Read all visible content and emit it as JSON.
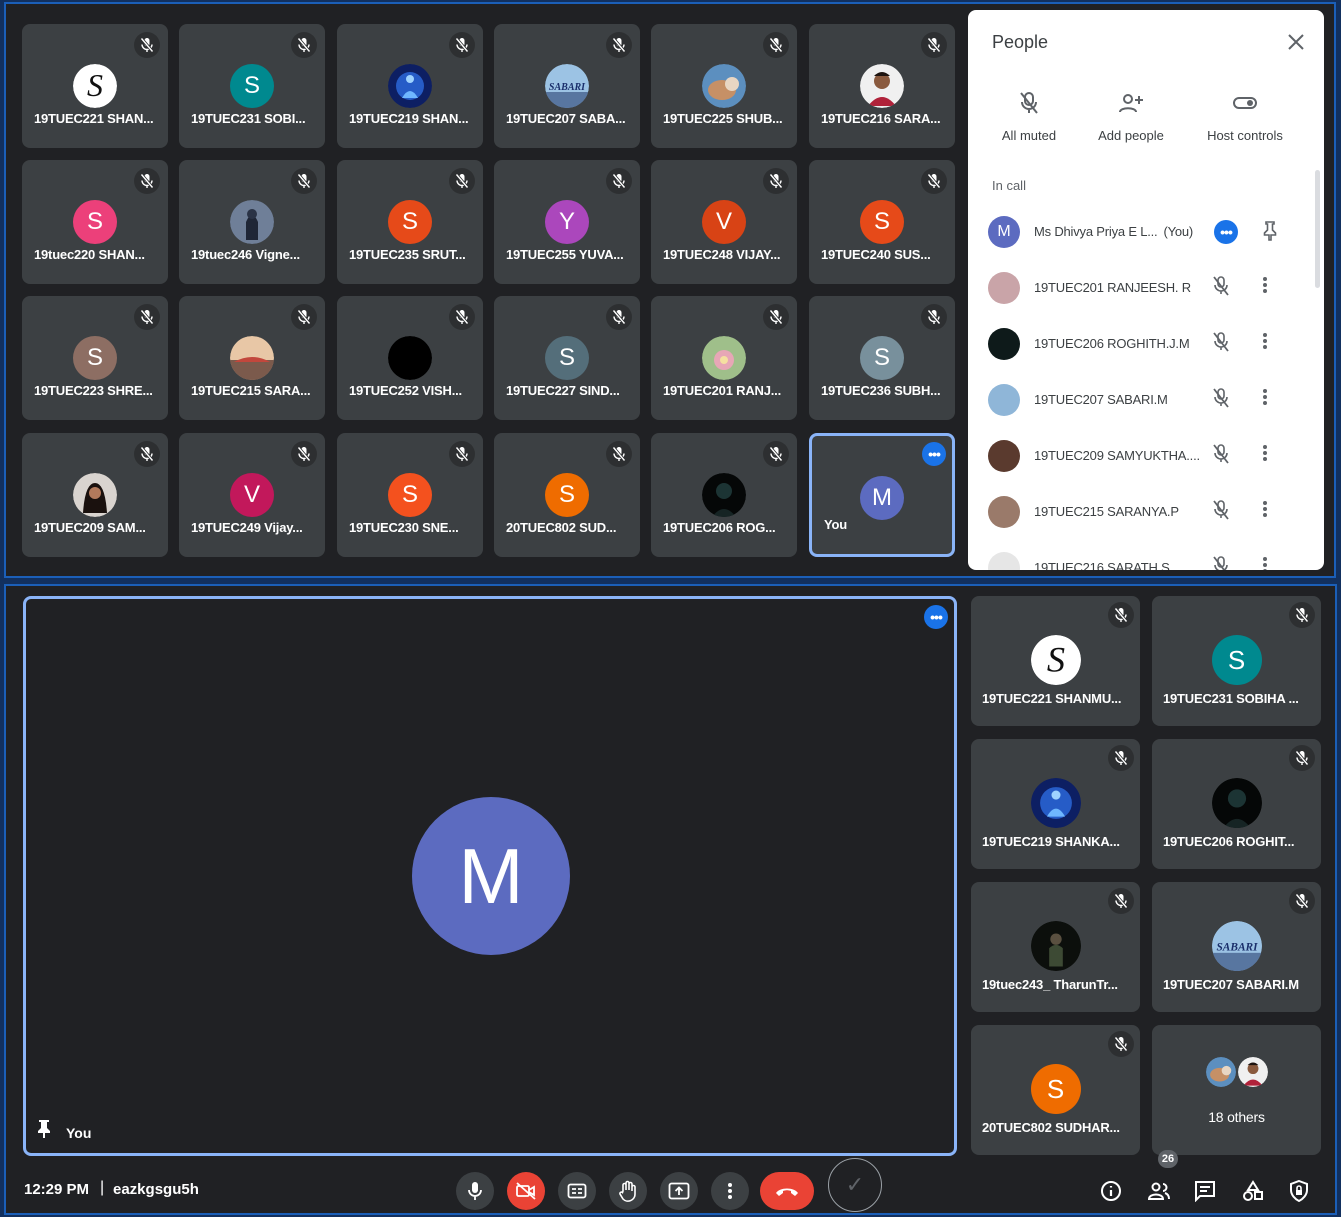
{
  "top_grid": {
    "tiles": [
      {
        "name": "19TUEC221 SHAN...",
        "initial": "",
        "avatar_color": "#ffffff",
        "avatar_type": "logo-s"
      },
      {
        "name": "19TUEC231 SOBI...",
        "initial": "S",
        "avatar_color": "#00898f",
        "avatar_type": "letter"
      },
      {
        "name": "19TUEC219 SHAN...",
        "initial": "",
        "avatar_color": "#1b3f9a",
        "avatar_type": "photo-blue"
      },
      {
        "name": "19TUEC207 SABA...",
        "initial": "",
        "avatar_color": "#8fb6d8",
        "avatar_type": "photo-sabari"
      },
      {
        "name": "19TUEC225 SHUB...",
        "initial": "",
        "avatar_color": "#b47c55",
        "avatar_type": "photo-cat"
      },
      {
        "name": "19TUEC216 SARA...",
        "initial": "",
        "avatar_color": "#e6e6e6",
        "avatar_type": "photo-man"
      },
      {
        "name": "19tuec220 SHAN...",
        "initial": "S",
        "avatar_color": "#ec407a",
        "avatar_type": "letter"
      },
      {
        "name": "19tuec246 Vigne...",
        "initial": "",
        "avatar_color": "#4a5a78",
        "avatar_type": "photo-statue"
      },
      {
        "name": "19TUEC235 SRUT...",
        "initial": "S",
        "avatar_color": "#e64a19",
        "avatar_type": "letter"
      },
      {
        "name": "19TUEC255 YUVA...",
        "initial": "Y",
        "avatar_color": "#ab47bc",
        "avatar_type": "letter"
      },
      {
        "name": "19TUEC248 VIJAY...",
        "initial": "V",
        "avatar_color": "#d84315",
        "avatar_type": "letter"
      },
      {
        "name": "19TUEC240 SUS...",
        "initial": "S",
        "avatar_color": "#e64a19",
        "avatar_type": "letter"
      },
      {
        "name": "19TUEC223 SHRE...",
        "initial": "S",
        "avatar_color": "#8d6e63",
        "avatar_type": "letter"
      },
      {
        "name": "19TUEC215 SARA...",
        "initial": "",
        "avatar_color": "#9a7a6a",
        "avatar_type": "photo-sunset"
      },
      {
        "name": "19TUEC252 VISH...",
        "initial": "",
        "avatar_color": "#000000",
        "avatar_type": "photo-black"
      },
      {
        "name": "19TUEC227 SIND...",
        "initial": "S",
        "avatar_color": "#546e7a",
        "avatar_type": "letter"
      },
      {
        "name": "19TUEC201 RANJ...",
        "initial": "",
        "avatar_color": "#c9a4a8",
        "avatar_type": "photo-flower"
      },
      {
        "name": "19TUEC236 SUBH...",
        "initial": "S",
        "avatar_color": "#78909c",
        "avatar_type": "letter"
      },
      {
        "name": "19TUEC209 SAM...",
        "initial": "",
        "avatar_color": "#5a3a2e",
        "avatar_type": "photo-girl"
      },
      {
        "name": "19TUEC249 Vijay...",
        "initial": "V",
        "avatar_color": "#c2185b",
        "avatar_type": "letter"
      },
      {
        "name": "19TUEC230 SNE...",
        "initial": "S",
        "avatar_color": "#f4511e",
        "avatar_type": "letter"
      },
      {
        "name": "20TUEC802 SUD...",
        "initial": "S",
        "avatar_color": "#ef6c00",
        "avatar_type": "letter"
      },
      {
        "name": "19TUEC206 ROG...",
        "initial": "",
        "avatar_color": "#0e1a1a",
        "avatar_type": "photo-dark"
      },
      {
        "name": "You",
        "initial": "M",
        "avatar_color": "#5c6bc0",
        "avatar_type": "letter",
        "is_self": true
      }
    ]
  },
  "people_panel": {
    "title": "People",
    "actions": [
      {
        "label": "All muted",
        "icon": "mic-off-icon"
      },
      {
        "label": "Add people",
        "icon": "add-person-icon"
      },
      {
        "label": "Host controls",
        "icon": "toggle-icon"
      }
    ],
    "section_label": "In call",
    "participants": [
      {
        "name": "Ms Dhivya Priya E L...",
        "suffix": "(You)",
        "initial": "M",
        "avatar_color": "#5c6bc0",
        "is_self": true
      },
      {
        "name": "19TUEC201 RANJEESH. R",
        "initial": "",
        "avatar_color": "#c9a4a8"
      },
      {
        "name": "19TUEC206 ROGHITH.J.M",
        "initial": "",
        "avatar_color": "#0e1a1a"
      },
      {
        "name": "19TUEC207 SABARI.M",
        "initial": "",
        "avatar_color": "#8fb6d8"
      },
      {
        "name": "19TUEC209 SAMYUKTHA....",
        "initial": "",
        "avatar_color": "#5a3a2e"
      },
      {
        "name": "19TUEC215 SARANYA.P",
        "initial": "",
        "avatar_color": "#9a7a6a"
      },
      {
        "name": "19TUEC216 SARATH S",
        "initial": "",
        "avatar_color": "#e6e6e6"
      }
    ]
  },
  "spotlight": {
    "main": {
      "name": "You",
      "initial": "M",
      "avatar_color": "#5c6bc0"
    },
    "side_tiles": [
      {
        "name": "19TUEC221 SHANMU...",
        "initial": "",
        "avatar_color": "#ffffff",
        "avatar_type": "logo-s"
      },
      {
        "name": "19TUEC231 SOBIHA ...",
        "initial": "S",
        "avatar_color": "#00898f",
        "avatar_type": "letter"
      },
      {
        "name": "19TUEC219 SHANKA...",
        "initial": "",
        "avatar_color": "#1b3f9a",
        "avatar_type": "photo-blue"
      },
      {
        "name": "19TUEC206 ROGHIT...",
        "initial": "",
        "avatar_color": "#0e1a1a",
        "avatar_type": "photo-dark"
      },
      {
        "name": "19tuec243_ TharunTr...",
        "initial": "",
        "avatar_color": "#1f2a22",
        "avatar_type": "photo-dark2"
      },
      {
        "name": "19TUEC207 SABARI.M",
        "initial": "",
        "avatar_color": "#8fb6d8",
        "avatar_type": "photo-sabari"
      },
      {
        "name": "20TUEC802 SUDHAR...",
        "initial": "S",
        "avatar_color": "#ef6c00",
        "avatar_type": "letter"
      }
    ],
    "others_label": "18 others"
  },
  "bottom_bar": {
    "time": "12:29 PM",
    "separator": "|",
    "meeting_code": "eazkgsgu5h",
    "people_count": "26",
    "colors": {
      "accent": "#1a73e8",
      "danger": "#ea4335",
      "selected_border": "#8ab4f8"
    }
  }
}
